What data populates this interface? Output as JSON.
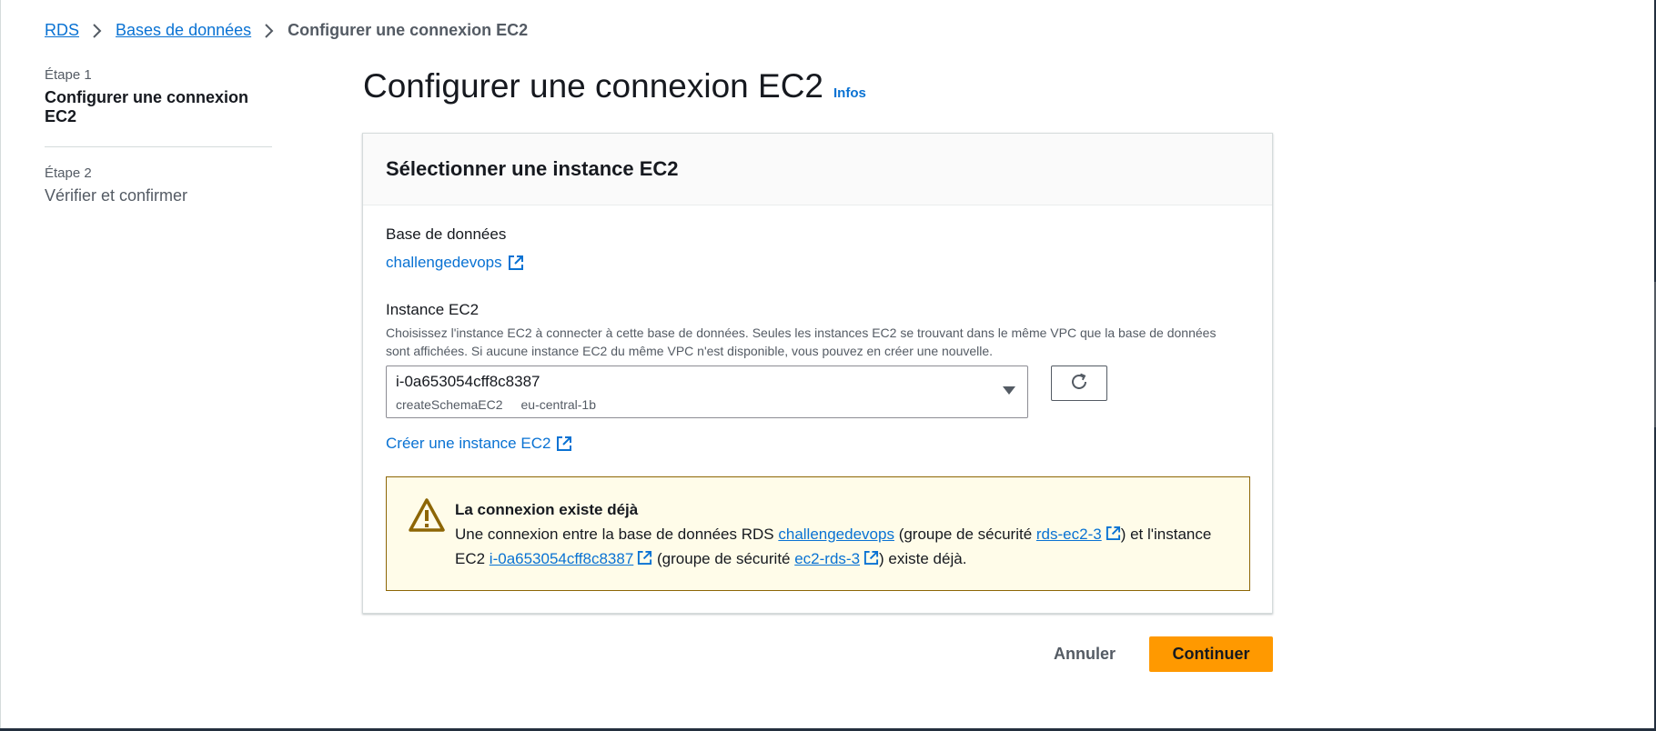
{
  "breadcrumb": {
    "items": [
      {
        "label": "RDS"
      },
      {
        "label": "Bases de données"
      }
    ],
    "current": "Configurer une connexion EC2"
  },
  "wizard": {
    "steps": [
      {
        "label": "Étape 1",
        "title": "Configurer une connexion EC2",
        "active": true
      },
      {
        "label": "Étape 2",
        "title": "Vérifier et confirmer",
        "active": false
      }
    ]
  },
  "page": {
    "title": "Configurer une connexion EC2",
    "info_label": "Infos"
  },
  "card": {
    "title": "Sélectionner une instance EC2",
    "database": {
      "label": "Base de données",
      "value": "challengedevops"
    },
    "instance": {
      "label": "Instance EC2",
      "description": "Choisissez l'instance EC2 à connecter à cette base de données. Seules les instances EC2 se trouvant dans le même VPC que la base de données sont affichées. Si aucune instance EC2 du même VPC n'est disponible, vous pouvez en créer une nouvelle.",
      "selected_id": "i-0a653054cff8c8387",
      "selected_name": "createSchemaEC2",
      "selected_zone": "eu-central-1b"
    },
    "create_link": "Créer une instance EC2",
    "alert": {
      "title": "La connexion existe déjà",
      "text_1": "Une connexion entre la base de données RDS ",
      "db_link": "challengedevops",
      "text_2": " (groupe de sécurité ",
      "db_sg_link": "rds-ec2-3",
      "text_3": ") et l'instance EC2 ",
      "instance_link": "i-0a653054cff8c8387",
      "text_4": " (groupe de sécurité ",
      "instance_sg_link": "ec2-rds-3",
      "text_5": ") existe déjà."
    }
  },
  "actions": {
    "cancel": "Annuler",
    "continue": "Continuer"
  },
  "colors": {
    "link": "#0972d3",
    "primary": "#ff9900",
    "warning_border": "#8d6605",
    "warning_bg": "#fffce9"
  },
  "icons": [
    "chevron-right-icon",
    "external-link-icon",
    "refresh-icon",
    "warning-icon",
    "caret-down-icon"
  ]
}
